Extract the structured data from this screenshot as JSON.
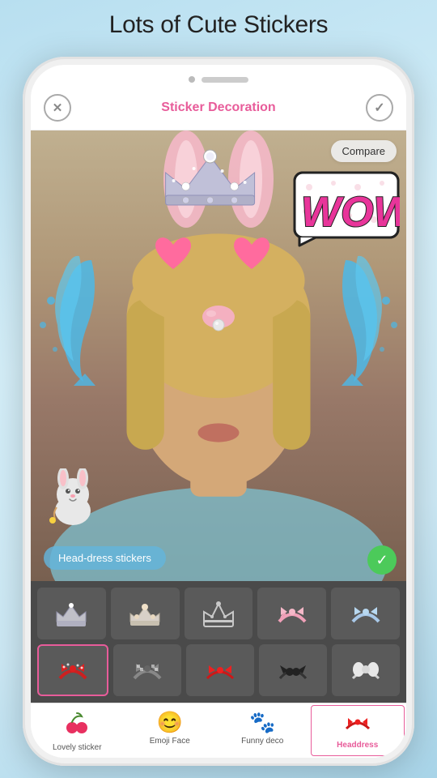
{
  "page": {
    "heading": "Lots of Cute Stickers"
  },
  "header": {
    "title": "Sticker Decoration",
    "close_label": "✕",
    "check_label": "✓"
  },
  "photo": {
    "compare_btn": "Compare",
    "headdress_label": "Head-dress stickers",
    "green_check": "✓"
  },
  "sticker_rows": [
    [
      "crown1",
      "crown2",
      "crown3",
      "bow_pink",
      "bow_blue"
    ],
    [
      "bow_red",
      "bow_checker",
      "bow_red2",
      "ears_black",
      "bow_white"
    ]
  ],
  "tabs": [
    {
      "id": "lovely",
      "label": "Lovely sticker",
      "icon": "🎀",
      "active": false
    },
    {
      "id": "emoji",
      "label": "Emoji Face",
      "icon": "😊",
      "active": false
    },
    {
      "id": "funny",
      "label": "Funny deco",
      "icon": "🐾",
      "active": false
    },
    {
      "id": "headdress",
      "label": "Headdress",
      "icon": "👑",
      "active": true
    }
  ],
  "colors": {
    "accent": "#e85c9a",
    "tab_active": "#e85c9a",
    "header_title": "#e85c9a",
    "green_check": "#4cca5a",
    "sticker_bg": "#4a4a4a"
  }
}
